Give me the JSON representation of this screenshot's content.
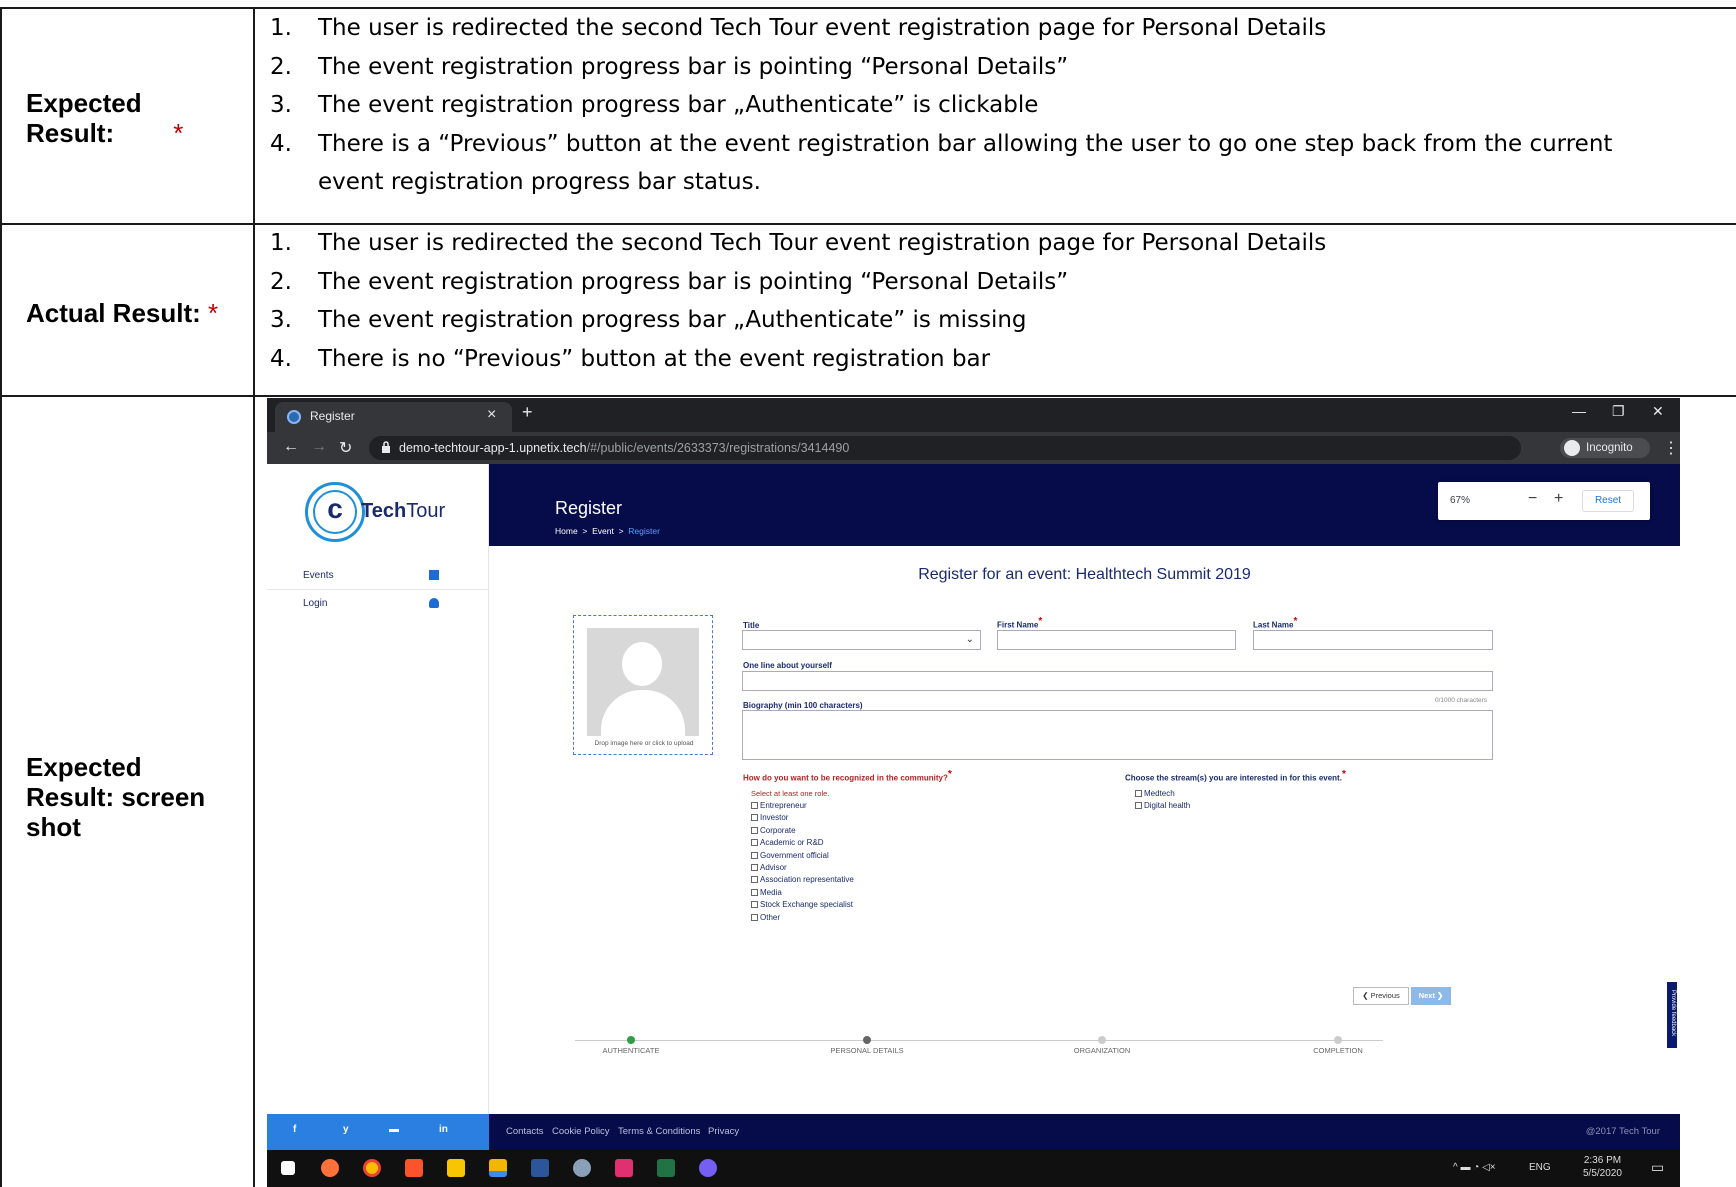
{
  "expected": {
    "label": "Expected Result:",
    "required_mark": "*",
    "items": [
      {
        "num": "1.",
        "text": "The user is redirected the second Tech Tour event registration page for Personal Details"
      },
      {
        "num": "2.",
        "text": "The event registration progress bar is pointing “Personal Details”"
      },
      {
        "num": "3.",
        "text": "The event registration progress bar „Authenticate” is clickable"
      },
      {
        "num": "4.",
        "text": "There is a “Previous” button at the event registration bar allowing the user to go one step back from the current"
      },
      {
        "num": "",
        "text": "event registration progress bar status."
      }
    ]
  },
  "actual": {
    "label": "Actual Result:",
    "required_mark": "*",
    "items": [
      {
        "num": "1.",
        "text": "The user is redirected the second Tech Tour event registration page for Personal Details"
      },
      {
        "num": "2.",
        "text": "The event registration progress bar is pointing “Personal Details”"
      },
      {
        "num": "3.",
        "text": "The event registration progress bar „Authenticate” is missing"
      },
      {
        "num": "4.",
        "text": "There is no “Previous” button at the event registration bar"
      }
    ]
  },
  "screenshot_row": {
    "label_line1": "Expected",
    "label_line2": "Result: screen",
    "label_line3": "shot"
  },
  "browser": {
    "tab_title": "Register",
    "url_host": "demo-techtour-app-1.upnetix.tech",
    "url_path": "/#/public/events/2633373/registrations/3414490",
    "incognito_label": "Incognito",
    "zoom_percent": "67%",
    "zoom_reset": "Reset"
  },
  "site": {
    "logo_bold": "Tech",
    "logo_rest": "Tour",
    "sidebar": [
      {
        "label": "Events",
        "icon": "calendar-icon"
      },
      {
        "label": "Login",
        "icon": "user-icon"
      }
    ],
    "banner_title": "Register",
    "breadcrumb": [
      "Home",
      "Event",
      "Register"
    ],
    "page_heading": "Register for an event: Healthtech Summit 2019",
    "upload_caption": "Drop image here or click to upload",
    "fields": {
      "title": "Title",
      "first_name": "First Name",
      "last_name": "Last Name",
      "one_line": "One line about yourself",
      "biography": "Biography (min 100 characters)",
      "biography_counter": "0/1000 characters"
    },
    "recognition": {
      "question": "How do you want to be recognized in the community?",
      "hint": "Select at least one role.",
      "options": [
        "Entrepreneur",
        "Investor",
        "Corporate",
        "Academic or R&D",
        "Government official",
        "Advisor",
        "Association representative",
        "Media",
        "Stock Exchange specialist",
        "Other"
      ]
    },
    "streams": {
      "question": "Choose the stream(s) you are interested in for this event.",
      "options": [
        "Medtech",
        "Digital health"
      ]
    },
    "buttons": {
      "previous": "❮ Previous",
      "next": "Next ❯"
    },
    "feedback_tab": "Provide feedback",
    "steps": [
      {
        "label": "AUTHENTICATE",
        "state": "done"
      },
      {
        "label": "PERSONAL DETAILS",
        "state": "current"
      },
      {
        "label": "ORGANIZATION",
        "state": "todo"
      },
      {
        "label": "COMPLETION",
        "state": "todo"
      }
    ],
    "footer": {
      "social": [
        "f",
        "y",
        "▬",
        "in"
      ],
      "links": [
        "Contacts",
        "Cookie Policy",
        "Terms & Conditions",
        "Privacy"
      ],
      "copyright": "@2017 Tech Tour"
    }
  },
  "taskbar": {
    "tray_lang": "ENG",
    "time": "2:36 PM",
    "date": "5/5/2020"
  },
  "colors": {
    "required": "#c00000",
    "navy": "#060b4a",
    "brand_blue": "#1e90d8",
    "step_done": "#2ea043"
  }
}
